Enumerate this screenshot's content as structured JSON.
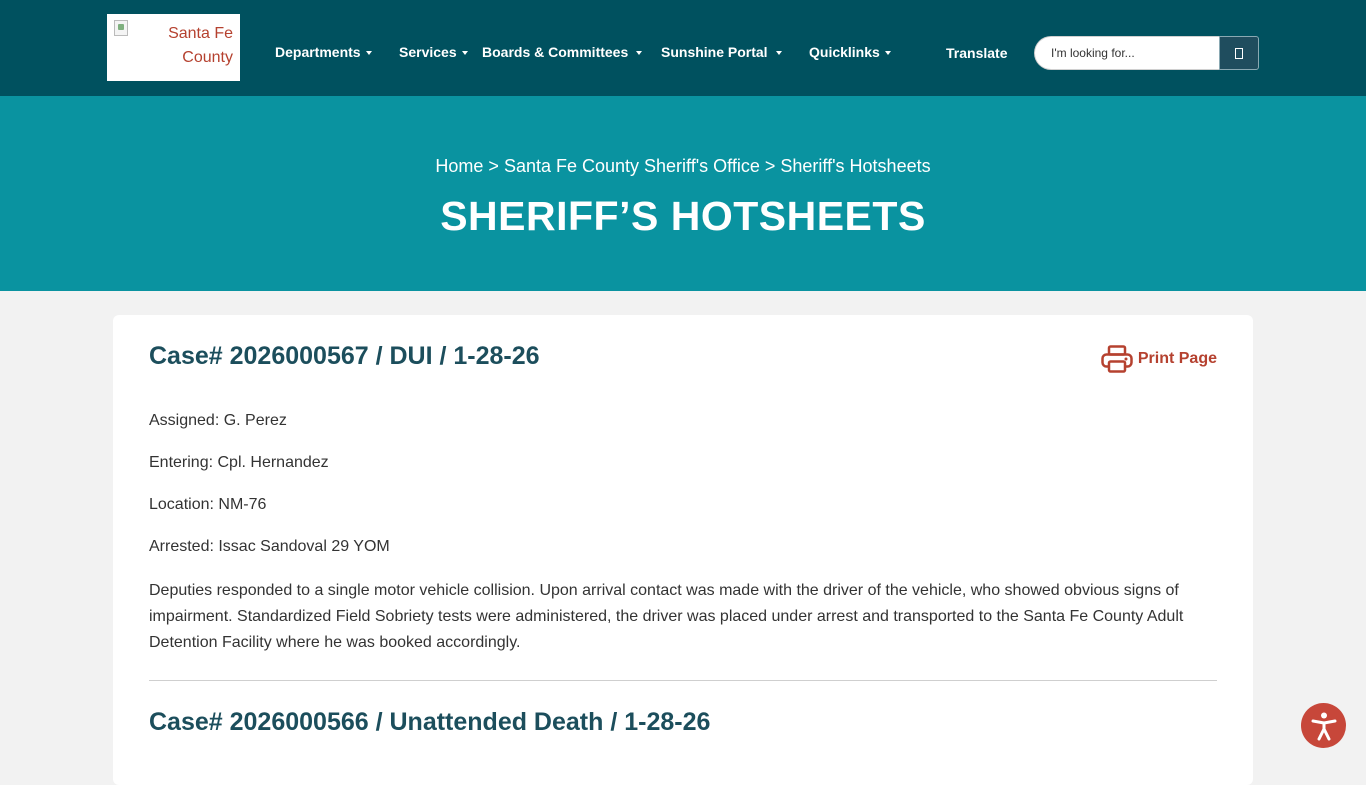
{
  "header": {
    "logo_text": "Santa Fe County",
    "nav": [
      {
        "label": "Departments"
      },
      {
        "label": "Services"
      },
      {
        "label": "Boards & Committees"
      },
      {
        "label": "Sunshine Portal"
      },
      {
        "label": "Quicklinks"
      }
    ],
    "translate_label": "Translate",
    "search_placeholder": "I'm looking for..."
  },
  "hero": {
    "breadcrumb": [
      "Home",
      "Santa Fe County Sheriff's Office",
      "Sheriff's Hotsheets"
    ],
    "separator": ">",
    "title": "SHERIFF’S HOTSHEETS"
  },
  "cases": [
    {
      "title": "Case# 2026000567 / DUI / 1-28-26",
      "assigned": "Assigned: G. Perez",
      "entering": "Entering: Cpl. Hernandez",
      "location": "Location: NM-76",
      "arrested": "Arrested: Issac Sandoval 29 YOM",
      "description": "Deputies responded to a single motor vehicle collision. Upon arrival contact was made with the driver of the vehicle, who showed obvious signs of impairment. Standardized Field Sobriety tests were administered, the driver was placed under arrest and transported to the Santa Fe County Adult Detention Facility where he was booked accordingly."
    },
    {
      "title": "Case# 2026000566 / Unattended Death / 1-28-26"
    }
  ],
  "print_label": "Print Page",
  "colors": {
    "topbar": "#00515f",
    "hero": "#0a93a0",
    "heading": "#1c4e5c",
    "accent": "#b5412f"
  },
  "icons": [
    "search-icon",
    "printer-icon",
    "accessibility-icon"
  ]
}
